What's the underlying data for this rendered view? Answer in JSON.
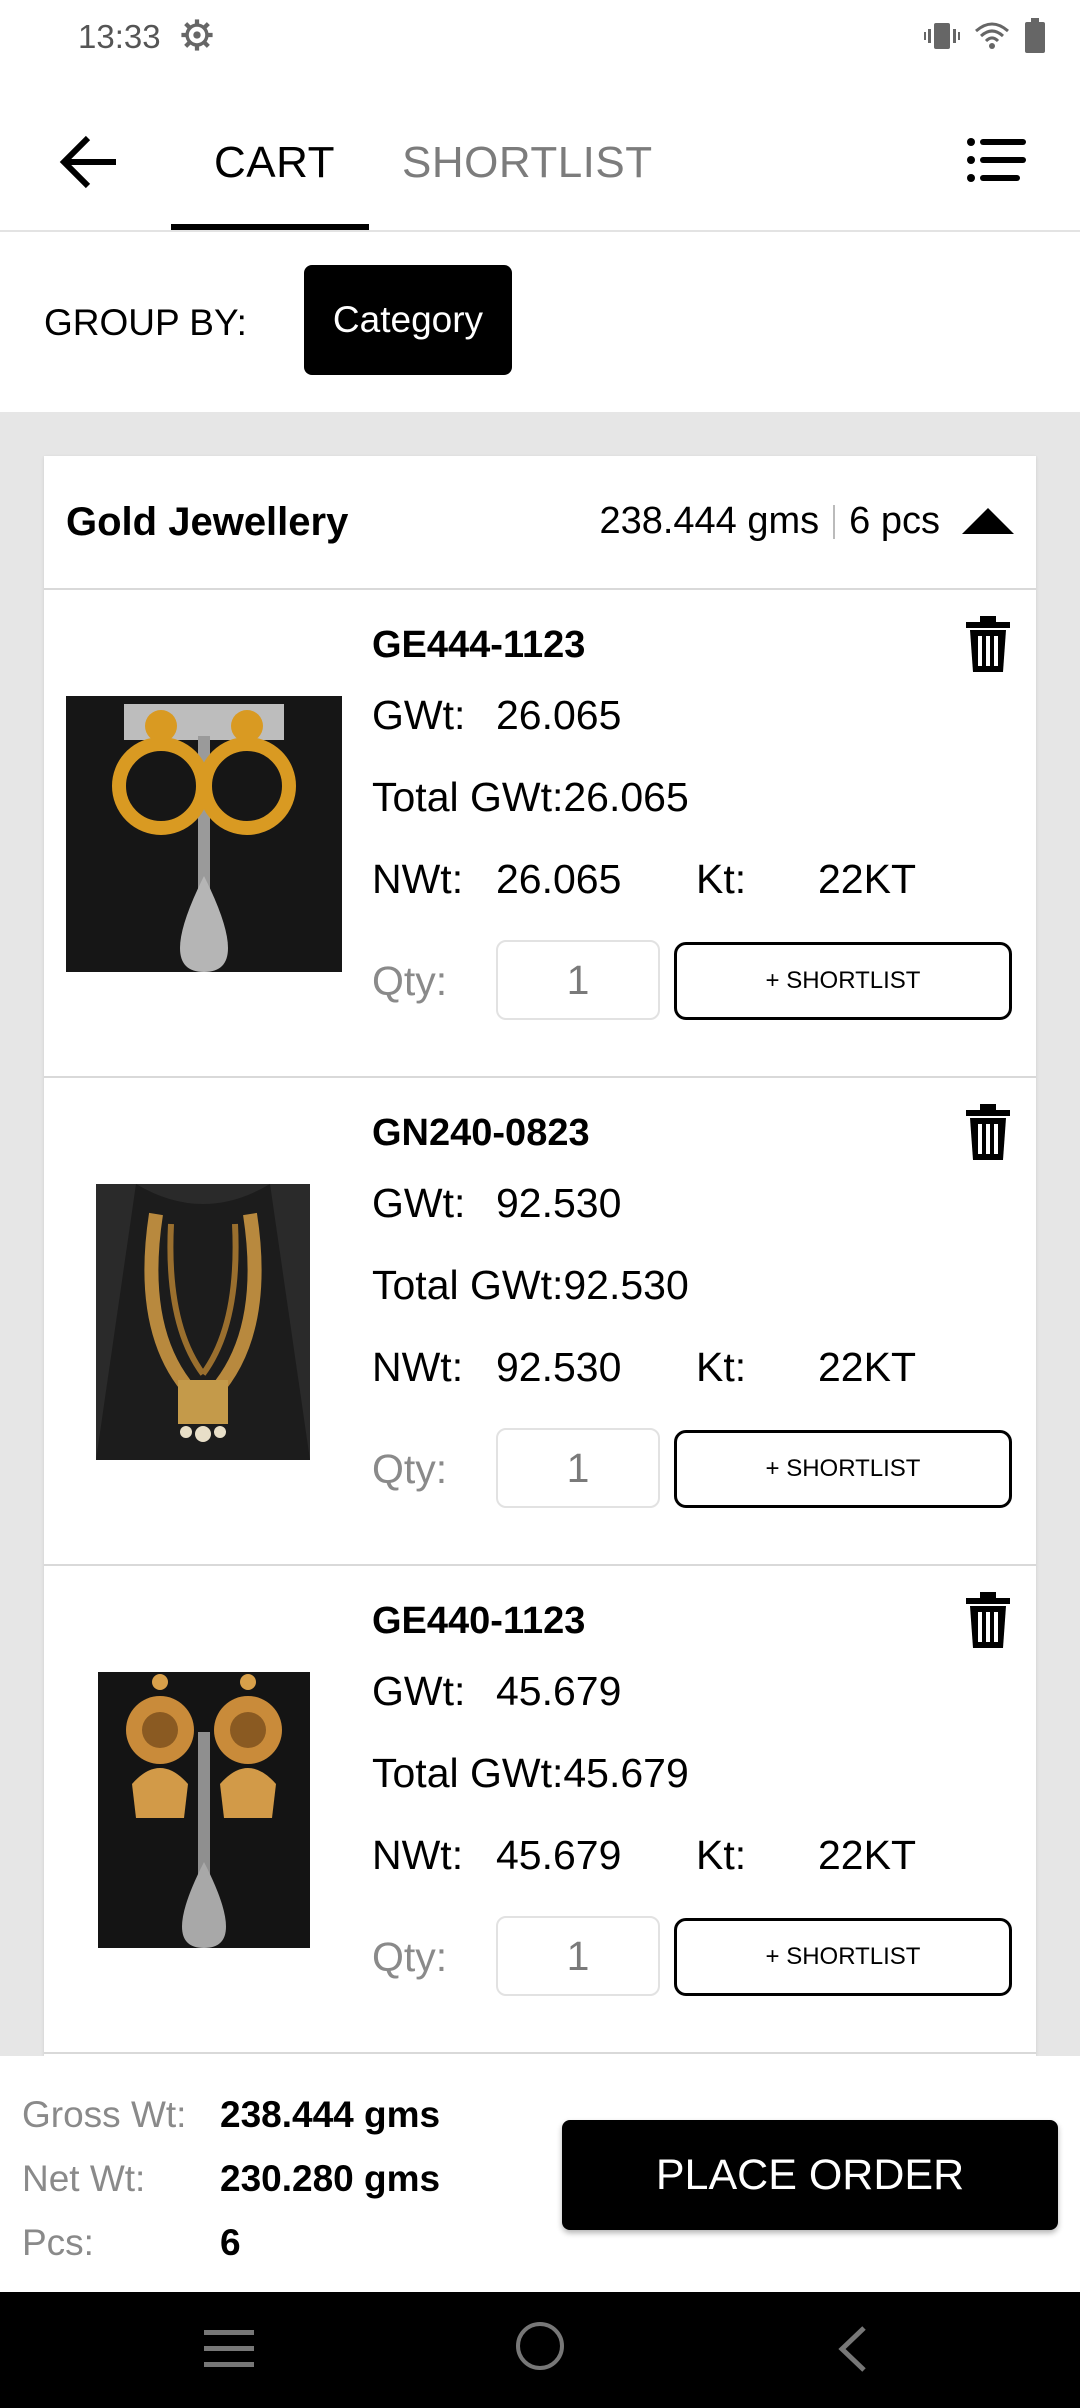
{
  "status": {
    "time": "13:33"
  },
  "nav": {
    "tabs": [
      {
        "label": "CART"
      },
      {
        "label": "SHORTLIST"
      }
    ],
    "active_tab": "CART"
  },
  "group": {
    "label": "GROUP BY:",
    "value": "Category"
  },
  "category": {
    "title": "Gold Jewellery",
    "weight": "238.444 gms",
    "pcs": "6 pcs"
  },
  "items": [
    {
      "code": "GE444-1123",
      "gwt_label": "GWt:",
      "gwt": "26.065",
      "total_gwt": "Total GWt:26.065",
      "nwt_label": "NWt:",
      "nwt": "26.065",
      "kt_label": "Kt:",
      "kt": "22KT",
      "qty_label": "Qty:",
      "qty": "1",
      "shortlist_label": "+ SHORTLIST"
    },
    {
      "code": "GN240-0823",
      "gwt_label": "GWt:",
      "gwt": "92.530",
      "total_gwt": "Total GWt:92.530",
      "nwt_label": "NWt:",
      "nwt": "92.530",
      "kt_label": "Kt:",
      "kt": "22KT",
      "qty_label": "Qty:",
      "qty": "1",
      "shortlist_label": "+ SHORTLIST"
    },
    {
      "code": "GE440-1123",
      "gwt_label": "GWt:",
      "gwt": "45.679",
      "total_gwt": "Total GWt:45.679",
      "nwt_label": "NWt:",
      "nwt": "45.679",
      "kt_label": "Kt:",
      "kt": "22KT",
      "qty_label": "Qty:",
      "qty": "1",
      "shortlist_label": "+ SHORTLIST"
    }
  ],
  "footer": {
    "gross_label": "Gross Wt:",
    "gross_value": "238.444 gms",
    "net_label": "Net Wt:",
    "net_value": "230.280 gms",
    "pcs_label": "Pcs:",
    "pcs_value": "6",
    "place_order": "PLACE ORDER"
  },
  "icons": [
    "settings-gear-icon",
    "vibrate-icon",
    "wifi-icon",
    "battery-icon",
    "back-arrow-icon",
    "list-menu-icon",
    "caret-up-icon",
    "trash-icon",
    "earring-product-image",
    "necklace-product-image",
    "jhumka-product-image",
    "nav-menu-icon",
    "nav-home-icon",
    "nav-back-icon"
  ],
  "colors": {
    "accent": "#000000",
    "muted_text": "#8a8a8a",
    "page_bg": "#e6e6e6"
  }
}
